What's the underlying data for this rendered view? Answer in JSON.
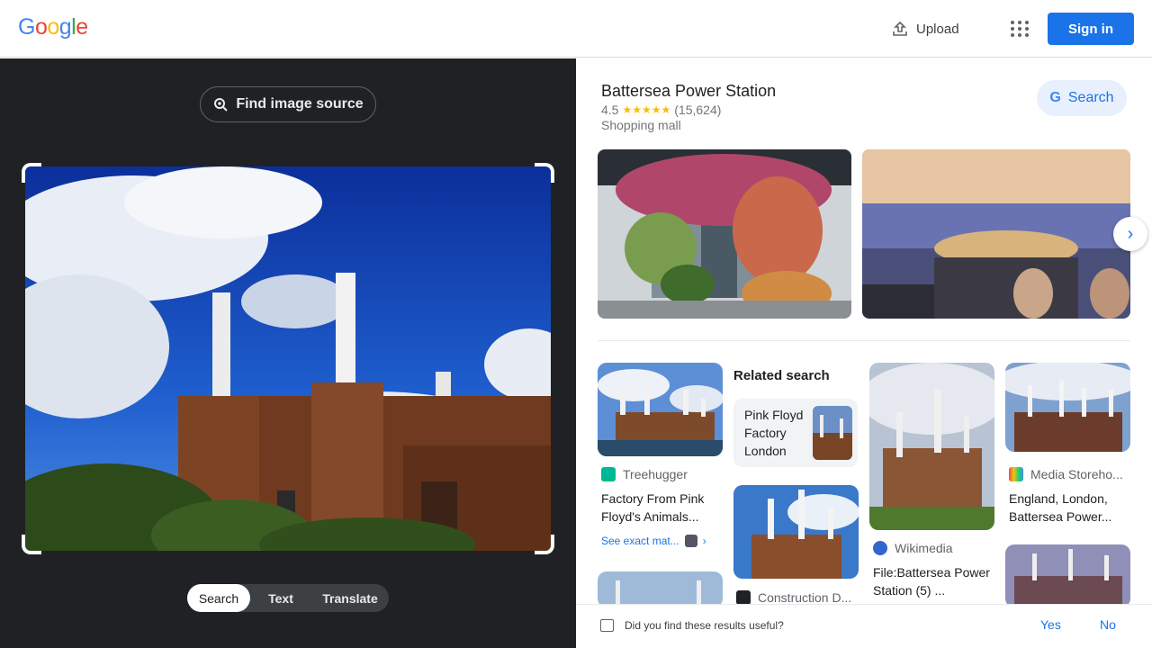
{
  "header": {
    "logo": "Google",
    "upload_label": "Upload",
    "apps_icon": "apps-grid-icon",
    "signin_label": "Sign in"
  },
  "lens": {
    "find_source_label": "Find image source",
    "modes": [
      "Search",
      "Text",
      "Translate"
    ],
    "active_mode": "Search"
  },
  "place": {
    "name": "Battersea Power Station",
    "rating": "4.5",
    "stars": "★★★★★",
    "reviews": "(15,624)",
    "type": "Shopping mall",
    "search_label": "Search"
  },
  "results": {
    "related_heading": "Related search",
    "related_query": "Pink Floyd Factory London",
    "cards": [
      {
        "source": "Treehugger",
        "title": "Factory From Pink Floyd's Animals...",
        "link": "See exact mat..."
      },
      {
        "source": "Construction D...",
        "title": ""
      },
      {
        "source": "Wikimedia",
        "title": "File:Battersea Power Station (5) ..."
      },
      {
        "source": "Media Storeho...",
        "title": "England, London, Battersea Power..."
      }
    ]
  },
  "feedback": {
    "question": "Did you find these results useful?",
    "yes": "Yes",
    "no": "No"
  },
  "colors": {
    "accent": "#1a73e8",
    "dark_pane": "#202124",
    "star": "#fbbc04"
  }
}
